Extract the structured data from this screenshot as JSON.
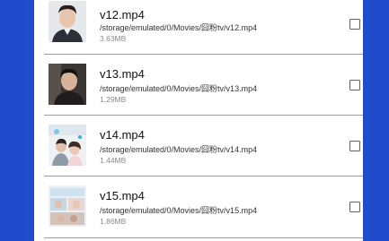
{
  "files": [
    {
      "name": "v12.mp4",
      "path": "/storage/emulated/0/Movies/囧粉tv/v12.mp4",
      "size": "3.63MB",
      "thumbnail": "portrait-man-suit-icon"
    },
    {
      "name": "v13.mp4",
      "path": "/storage/emulated/0/Movies/囧粉tv/v13.mp4",
      "size": "1.29MB",
      "thumbnail": "portrait-man-dark-icon"
    },
    {
      "name": "v14.mp4",
      "path": "/storage/emulated/0/Movies/囧粉tv/v14.mp4",
      "size": "1.44MB",
      "thumbnail": "couple-scene-icon"
    },
    {
      "name": "v15.mp4",
      "path": "/storage/emulated/0/Movies/囧粉tv/v15.mp4",
      "size": "1.86MB",
      "thumbnail": "collage-scene-icon"
    }
  ],
  "colors": {
    "background_blue": "#2a5fe3",
    "panel": "#ffffff",
    "divider": "#9e9e9e",
    "size_text": "#8a8a8a"
  }
}
